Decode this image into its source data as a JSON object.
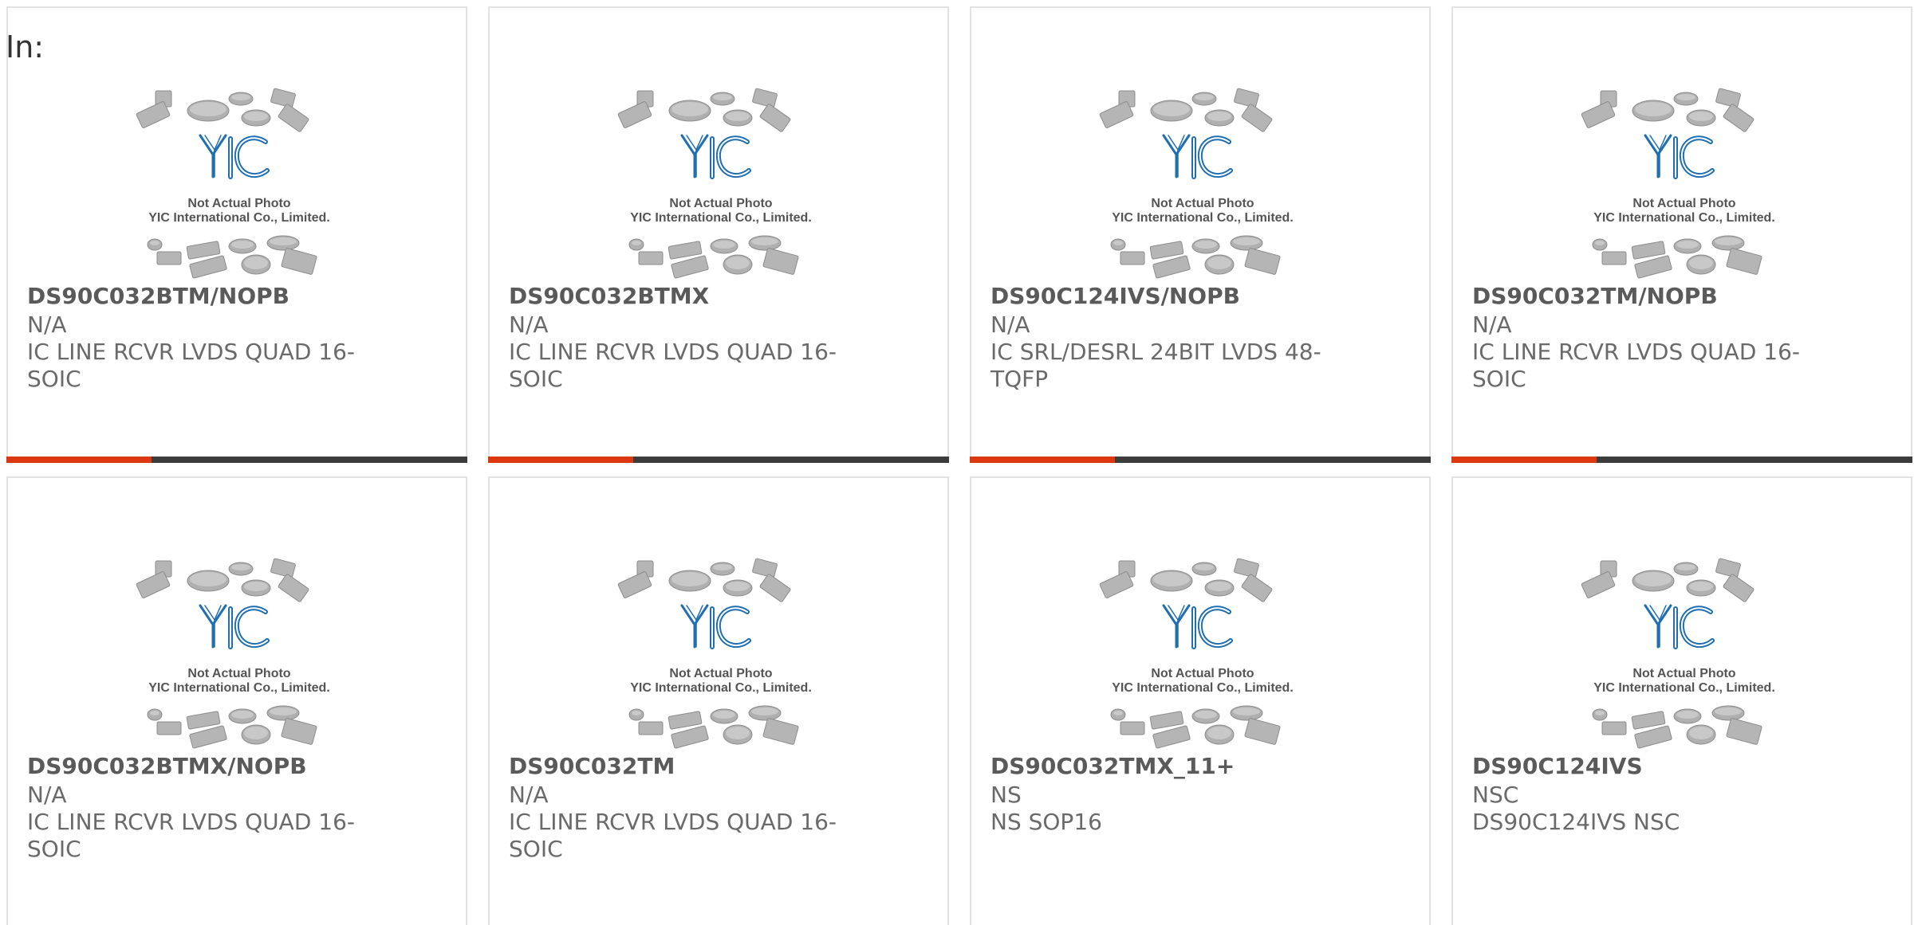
{
  "header": {
    "in_label": "In:"
  },
  "placeholder": {
    "line1": "Not Actual Photo",
    "line2": "YIC International Co., Limited.",
    "logo_text": "YIC"
  },
  "colors": {
    "accent": "#dc3810",
    "bar": "#3c3c3c",
    "logo": "#1f6fb2"
  },
  "products": [
    {
      "part_number": "DS90C032BTM/NOPB",
      "manufacturer": "N/A",
      "description": "IC LINE RCVR LVDS QUAD 16-SOIC"
    },
    {
      "part_number": "DS90C032BTMX",
      "manufacturer": "N/A",
      "description": "IC LINE RCVR LVDS QUAD 16-SOIC"
    },
    {
      "part_number": "DS90C124IVS/NOPB",
      "manufacturer": "N/A",
      "description": "IC SRL/DESRL 24BIT LVDS 48-TQFP"
    },
    {
      "part_number": "DS90C032TM/NOPB",
      "manufacturer": "N/A",
      "description": "IC LINE RCVR LVDS QUAD 16-SOIC"
    },
    {
      "part_number": "DS90C032BTMX/NOPB",
      "manufacturer": "N/A",
      "description": "IC LINE RCVR LVDS QUAD 16-SOIC"
    },
    {
      "part_number": "DS90C032TM",
      "manufacturer": "N/A",
      "description": "IC LINE RCVR LVDS QUAD 16-SOIC"
    },
    {
      "part_number": "DS90C032TMX_11+",
      "manufacturer": "NS",
      "description": "NS SOP16"
    },
    {
      "part_number": "DS90C124IVS",
      "manufacturer": "NSC",
      "description": "DS90C124IVS NSC"
    }
  ]
}
